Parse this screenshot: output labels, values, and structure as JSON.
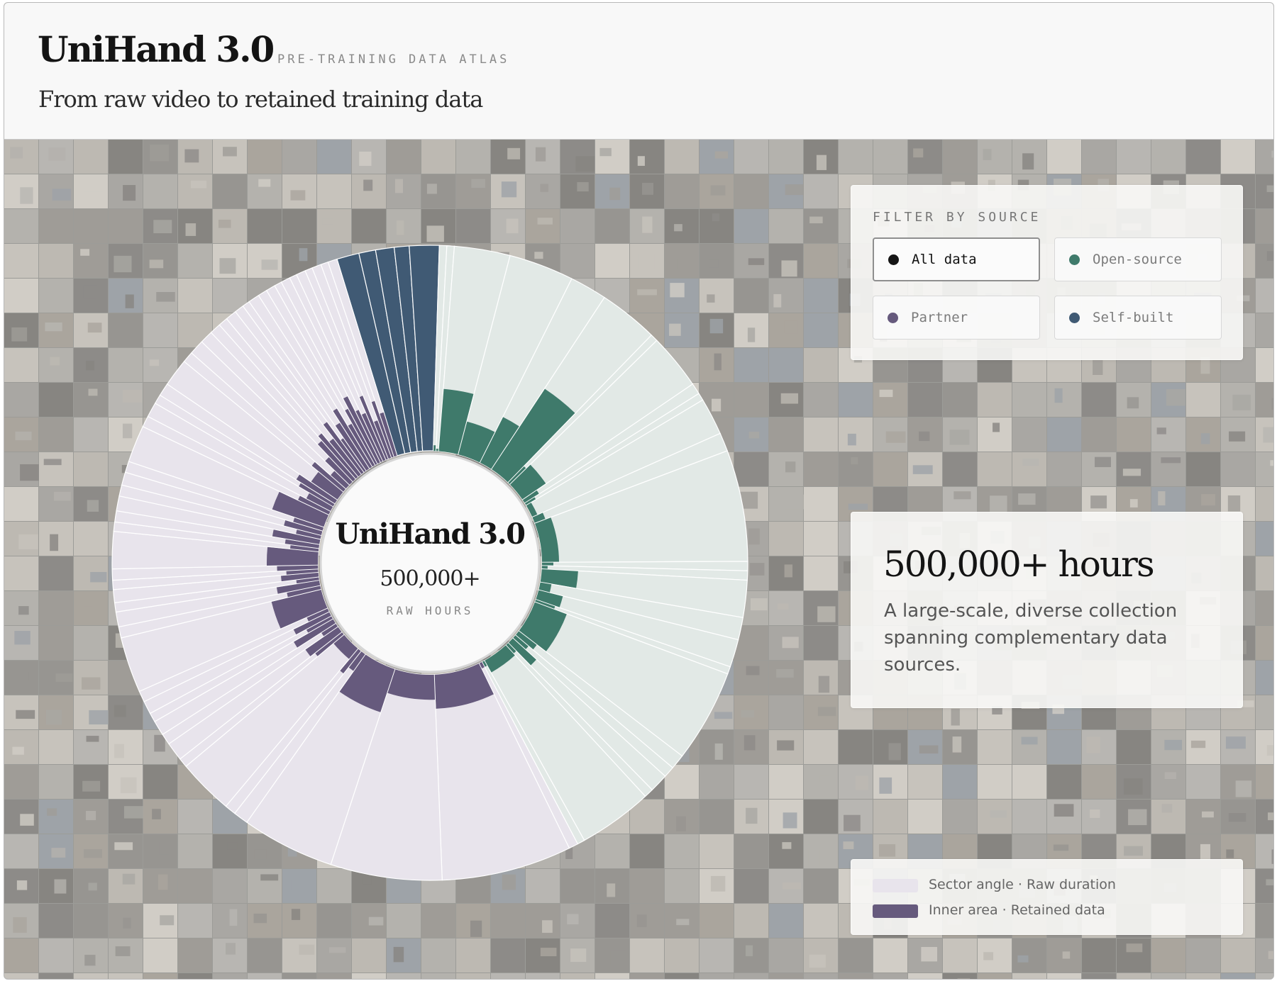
{
  "header": {
    "title": "UniHand 3.0",
    "kicker": "PRE-TRAINING DATA ATLAS",
    "subtitle": "From raw video to retained training data"
  },
  "chart_center": {
    "title": "UniHand 3.0",
    "value": "500,000+",
    "label": "RAW HOURS"
  },
  "filter": {
    "title": "FILTER BY SOURCE",
    "buttons": [
      {
        "label": "All data",
        "color": "#151515",
        "active": true
      },
      {
        "label": "Open-source",
        "color": "#3f7a6b",
        "active": false
      },
      {
        "label": "Partner",
        "color": "#665a7d",
        "active": false
      },
      {
        "label": "Self-built",
        "color": "#405a74",
        "active": false
      }
    ]
  },
  "info": {
    "headline": "500,000+ hours",
    "body": "A large-scale, diverse collection spanning complementary data sources."
  },
  "legend": {
    "items": [
      {
        "label": "Sector angle · Raw duration",
        "color": "#e8e4ec"
      },
      {
        "label": "Inner area · Retained data",
        "color": "#665a7d"
      }
    ]
  },
  "colors": {
    "open_source": "#3f7a6b",
    "open_source_light": "#e2e9e6",
    "partner": "#665a7d",
    "partner_light": "#e8e4ec",
    "self_built": "#405a74"
  },
  "chart_data": {
    "type": "radial-sunburst",
    "center_label": "500,000+ RAW HOURS",
    "segment_order": [
      "self-built",
      "open-source",
      "partner"
    ],
    "raw_duration_share": {
      "self-built": 0.055,
      "open-source": 0.39,
      "partner": 0.555
    },
    "segments": [
      {
        "source": "self-built",
        "raw": 0.012
      },
      {
        "source": "self-built",
        "raw": 0.009
      },
      {
        "source": "self-built",
        "raw": 0.01
      },
      {
        "source": "self-built",
        "raw": 0.008
      },
      {
        "source": "self-built",
        "raw": 0.016
      },
      {
        "source": "open-source",
        "raw": 0.004,
        "retained": 0.05
      },
      {
        "source": "open-source",
        "raw": 0.004,
        "retained": 0.02
      },
      {
        "source": "open-source",
        "raw": 0.03,
        "retained": 0.55
      },
      {
        "source": "open-source",
        "raw": 0.035,
        "retained": 0.3
      },
      {
        "source": "open-source",
        "raw": 0.02,
        "retained": 0.45
      },
      {
        "source": "open-source",
        "raw": 0.032,
        "retained": 0.85
      },
      {
        "source": "open-source",
        "raw": 0.004,
        "retained": 0.2
      },
      {
        "source": "open-source",
        "raw": 0.03,
        "retained": 0.25
      },
      {
        "source": "open-source",
        "raw": 0.006,
        "retained": 0.15
      },
      {
        "source": "open-source",
        "raw": 0.004,
        "retained": 0.1
      },
      {
        "source": "open-source",
        "raw": 0.02,
        "retained": 0.05
      },
      {
        "source": "open-source",
        "raw": 0.01,
        "retained": 0.1
      },
      {
        "source": "open-source",
        "raw": 0.06,
        "retained": 0.15
      },
      {
        "source": "open-source",
        "raw": 0.005,
        "retained": 0.1
      },
      {
        "source": "open-source",
        "raw": 0.005,
        "retained": 0.05
      },
      {
        "source": "open-source",
        "raw": 0.02,
        "retained": 0.32
      },
      {
        "source": "open-source",
        "raw": 0.012,
        "retained": 0.1
      },
      {
        "source": "open-source",
        "raw": 0.015,
        "retained": 0.22
      },
      {
        "source": "open-source",
        "raw": 0.004,
        "retained": 0.18
      },
      {
        "source": "open-source",
        "raw": 0.05,
        "retained": 0.3
      },
      {
        "source": "open-source",
        "raw": 0.008,
        "retained": 0.2
      },
      {
        "source": "open-source",
        "raw": 0.006,
        "retained": 0.15
      },
      {
        "source": "open-source",
        "raw": 0.01,
        "retained": 0.28
      },
      {
        "source": "open-source",
        "raw": 0.005,
        "retained": 0.1
      },
      {
        "source": "open-source",
        "raw": 0.04,
        "retained": 0.12
      },
      {
        "source": "open-source",
        "raw": 0.004,
        "retained": 0.05
      },
      {
        "source": "partner",
        "raw": 0.005,
        "retained": 0.05
      },
      {
        "source": "partner",
        "raw": 0.07,
        "retained": 0.3
      },
      {
        "source": "partner",
        "raw": 0.06,
        "retained": 0.22
      },
      {
        "source": "partner",
        "raw": 0.05,
        "retained": 0.4
      },
      {
        "source": "partner",
        "raw": 0.008,
        "retained": 0.18
      },
      {
        "source": "partner",
        "raw": 0.006,
        "retained": 0.25
      },
      {
        "source": "partner",
        "raw": 0.03,
        "retained": 0.12
      },
      {
        "source": "partner",
        "raw": 0.005,
        "retained": 0.3
      },
      {
        "source": "partner",
        "raw": 0.01,
        "retained": 0.35
      },
      {
        "source": "partner",
        "raw": 0.006,
        "retained": 0.15
      },
      {
        "source": "partner",
        "raw": 0.008,
        "retained": 0.4
      },
      {
        "source": "partner",
        "raw": 0.005,
        "retained": 0.25
      },
      {
        "source": "partner",
        "raw": 0.007,
        "retained": 0.35
      },
      {
        "source": "partner",
        "raw": 0.006,
        "retained": 0.2
      },
      {
        "source": "partner",
        "raw": 0.03,
        "retained": 0.45
      },
      {
        "source": "partner",
        "raw": 0.006,
        "retained": 0.3
      },
      {
        "source": "partner",
        "raw": 0.008,
        "retained": 0.38
      },
      {
        "source": "partner",
        "raw": 0.005,
        "retained": 0.2
      },
      {
        "source": "partner",
        "raw": 0.007,
        "retained": 0.33
      },
      {
        "source": "partner",
        "raw": 0.005,
        "retained": 0.28
      },
      {
        "source": "partner",
        "raw": 0.006,
        "retained": 0.36
      },
      {
        "source": "partner",
        "raw": 0.02,
        "retained": 0.45
      },
      {
        "source": "partner",
        "raw": 0.005,
        "retained": 0.25
      },
      {
        "source": "partner",
        "raw": 0.006,
        "retained": 0.3
      },
      {
        "source": "partner",
        "raw": 0.008,
        "retained": 0.42
      },
      {
        "source": "partner",
        "raw": 0.006,
        "retained": 0.22
      },
      {
        "source": "partner",
        "raw": 0.007,
        "retained": 0.34
      },
      {
        "source": "partner",
        "raw": 0.006,
        "retained": 0.27
      },
      {
        "source": "partner",
        "raw": 0.02,
        "retained": 0.48
      },
      {
        "source": "partner",
        "raw": 0.006,
        "retained": 0.3
      },
      {
        "source": "partner",
        "raw": 0.008,
        "retained": 0.24
      },
      {
        "source": "partner",
        "raw": 0.005,
        "retained": 0.35
      },
      {
        "source": "partner",
        "raw": 0.007,
        "retained": 0.4
      },
      {
        "source": "partner",
        "raw": 0.015,
        "retained": 0.28
      },
      {
        "source": "partner",
        "raw": 0.006,
        "retained": 0.36
      },
      {
        "source": "partner",
        "raw": 0.008,
        "retained": 0.18
      },
      {
        "source": "partner",
        "raw": 0.007,
        "retained": 0.3
      },
      {
        "source": "partner",
        "raw": 0.006,
        "retained": 0.45
      },
      {
        "source": "partner",
        "raw": 0.005,
        "retained": 0.5
      },
      {
        "source": "partner",
        "raw": 0.006,
        "retained": 0.4
      },
      {
        "source": "partner",
        "raw": 0.005,
        "retained": 0.55
      },
      {
        "source": "partner",
        "raw": 0.004,
        "retained": 0.35
      },
      {
        "source": "partner",
        "raw": 0.006,
        "retained": 0.48
      },
      {
        "source": "partner",
        "raw": 0.005,
        "retained": 0.6
      },
      {
        "source": "partner",
        "raw": 0.005,
        "retained": 0.42
      },
      {
        "source": "partner",
        "raw": 0.004,
        "retained": 0.55
      },
      {
        "source": "partner",
        "raw": 0.005,
        "retained": 0.65
      },
      {
        "source": "partner",
        "raw": 0.004,
        "retained": 0.5
      },
      {
        "source": "partner",
        "raw": 0.005,
        "retained": 0.45
      },
      {
        "source": "partner",
        "raw": 0.004,
        "retained": 0.6
      },
      {
        "source": "partner",
        "raw": 0.005,
        "retained": 0.35
      },
      {
        "source": "partner",
        "raw": 0.004,
        "retained": 0.52
      },
      {
        "source": "partner",
        "raw": 0.005,
        "retained": 0.4
      }
    ]
  }
}
